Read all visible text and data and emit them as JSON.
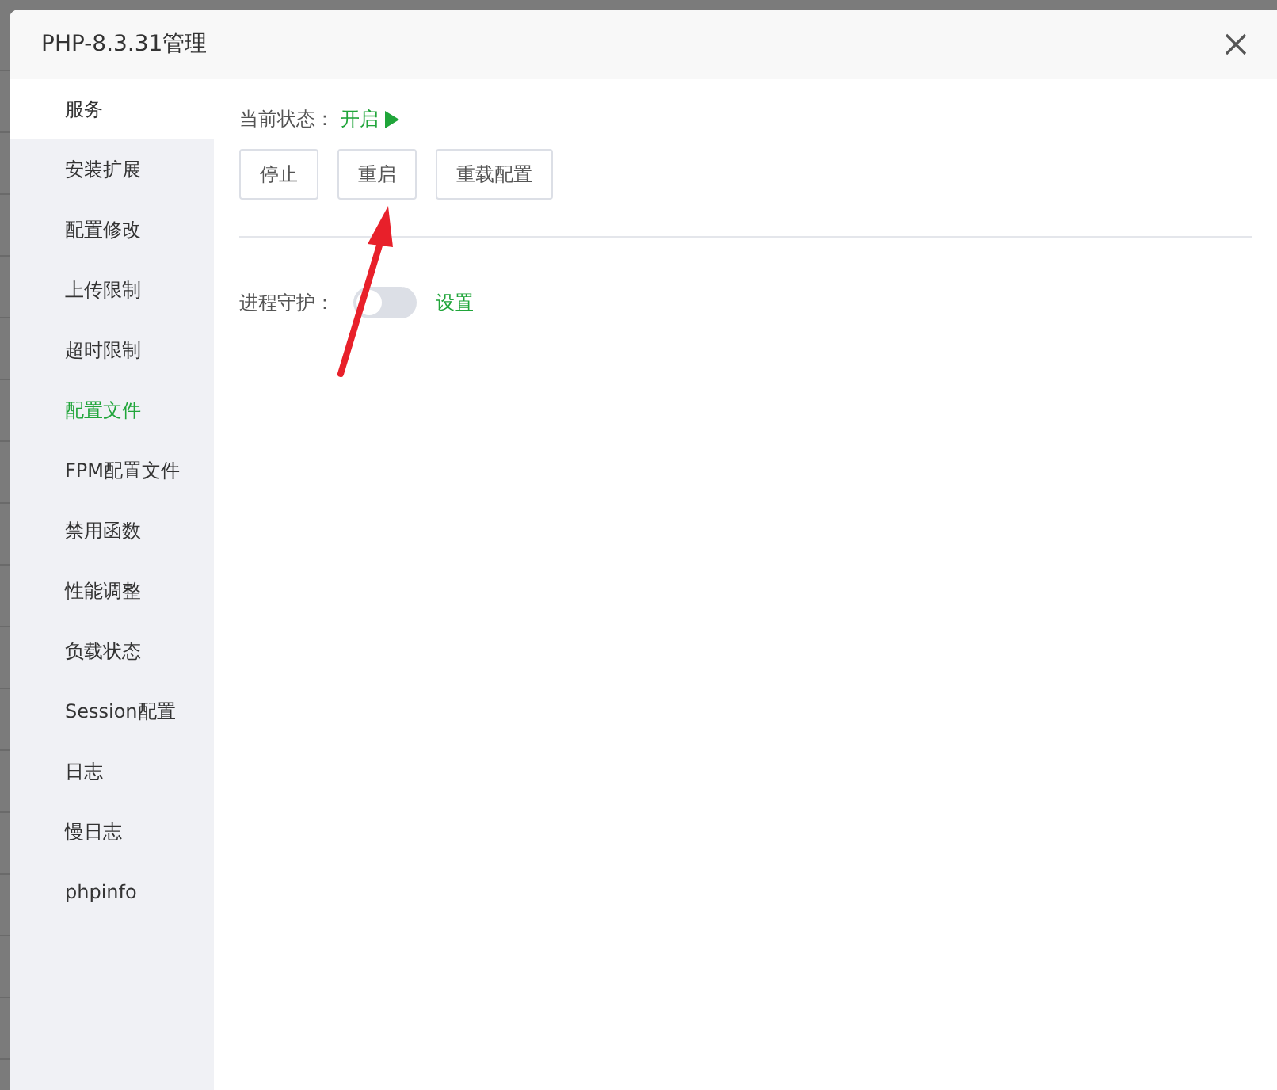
{
  "window": {
    "title": "PHP-8.3.31管理"
  },
  "sidebar": {
    "items": [
      {
        "label": "服务",
        "selected": true,
        "highlighted": false
      },
      {
        "label": "安装扩展",
        "selected": false,
        "highlighted": false
      },
      {
        "label": "配置修改",
        "selected": false,
        "highlighted": false
      },
      {
        "label": "上传限制",
        "selected": false,
        "highlighted": false
      },
      {
        "label": "超时限制",
        "selected": false,
        "highlighted": false
      },
      {
        "label": "配置文件",
        "selected": false,
        "highlighted": true
      },
      {
        "label": "FPM配置文件",
        "selected": false,
        "highlighted": false
      },
      {
        "label": "禁用函数",
        "selected": false,
        "highlighted": false
      },
      {
        "label": "性能调整",
        "selected": false,
        "highlighted": false
      },
      {
        "label": "负载状态",
        "selected": false,
        "highlighted": false
      },
      {
        "label": "Session配置",
        "selected": false,
        "highlighted": false
      },
      {
        "label": "日志",
        "selected": false,
        "highlighted": false
      },
      {
        "label": "慢日志",
        "selected": false,
        "highlighted": false
      },
      {
        "label": "phpinfo",
        "selected": false,
        "highlighted": false
      }
    ]
  },
  "status": {
    "label": "当前状态：",
    "value": "开启",
    "running": true
  },
  "buttons": [
    "停止",
    "重启",
    "重载配置"
  ],
  "guard": {
    "label": "进程守护：",
    "on": false,
    "link": "设置"
  }
}
